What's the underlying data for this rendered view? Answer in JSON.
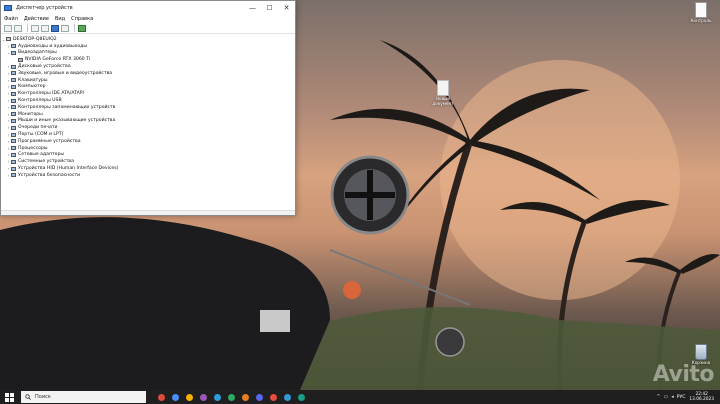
{
  "window": {
    "title": "Диспетчер устройств",
    "controls": {
      "minimize": "—",
      "maximize": "☐",
      "close": "✕"
    },
    "menu": [
      "Файл",
      "Действие",
      "Вид",
      "Справка"
    ]
  },
  "tree": {
    "root": "DESKTOP-Q8EUIQ2",
    "items": [
      {
        "label": "Аудиовходы и аудиовыходы",
        "expander": "›"
      },
      {
        "label": "Видеоадаптеры",
        "expander": "⌄"
      },
      {
        "label": "NVIDIA GeForce RTX 3060 Ti",
        "expander": "",
        "child": true
      },
      {
        "label": "Дисковые устройства",
        "expander": "›"
      },
      {
        "label": "Звуковые, игровые и видеоустройства",
        "expander": "›"
      },
      {
        "label": "Клавиатуры",
        "expander": "›"
      },
      {
        "label": "Компьютер",
        "expander": "›"
      },
      {
        "label": "Контроллеры IDE ATA/ATAPI",
        "expander": "›"
      },
      {
        "label": "Контроллеры USB",
        "expander": "›"
      },
      {
        "label": "Контроллеры запоминающих устройств",
        "expander": "›"
      },
      {
        "label": "Мониторы",
        "expander": "›"
      },
      {
        "label": "Мыши и иные указывающие устройства",
        "expander": "›"
      },
      {
        "label": "Очереди печати",
        "expander": "›"
      },
      {
        "label": "Порты (COM и LPT)",
        "expander": "›"
      },
      {
        "label": "Программные устройства",
        "expander": "›"
      },
      {
        "label": "Процессоры",
        "expander": "›"
      },
      {
        "label": "Сетевые адаптеры",
        "expander": "›"
      },
      {
        "label": "Системные устройства",
        "expander": "›"
      },
      {
        "label": "Устройства HID (Human Interface Devices)",
        "expander": "›"
      },
      {
        "label": "Устройства безопасности",
        "expander": "›"
      }
    ]
  },
  "desktop": {
    "icons": [
      {
        "label": "Контроль",
        "icon": "documents-icon"
      },
      {
        "label": "Новый документ",
        "icon": "file-icon"
      },
      {
        "label": "Корзина",
        "icon": "recycle-bin-icon"
      }
    ]
  },
  "taskbar": {
    "search_label": "Поиск",
    "language": "РУС",
    "time": "22:42",
    "date": "13.06.2023",
    "app_colors": [
      "#e04b3f",
      "#4b8df8",
      "#f4b400",
      "#9b59b6",
      "#2d9cdb",
      "#27ae60",
      "#e67e22",
      "#5865f2",
      "#e74c3c",
      "#3498db",
      "#16a085"
    ]
  },
  "watermark": "Avito"
}
